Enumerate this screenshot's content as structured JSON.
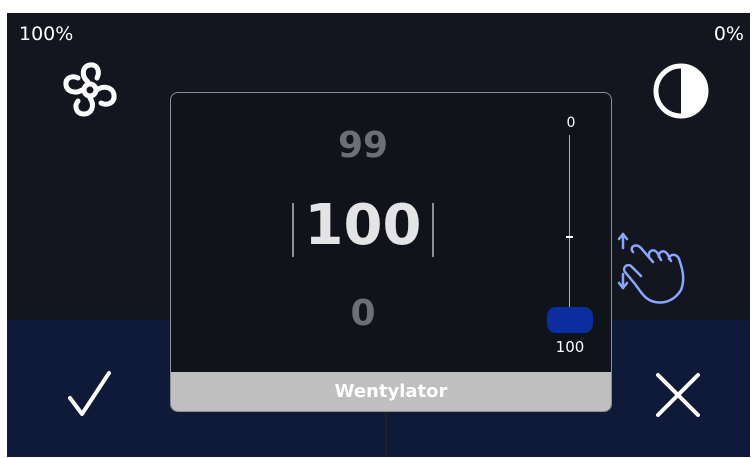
{
  "status": {
    "fan_percent": "100%",
    "contrast_percent": "0%"
  },
  "icons": {
    "fan": "fan-icon",
    "contrast": "contrast-icon",
    "gesture": "swipe-gesture-icon",
    "confirm": "checkmark-icon",
    "cancel": "close-icon"
  },
  "dialog": {
    "title": "Wentylator",
    "picker": {
      "previous": "99",
      "current": "100",
      "next": "0"
    },
    "slider": {
      "min_label": "0",
      "max_label": "100",
      "value": 100,
      "min": 0,
      "max": 100
    }
  },
  "colors": {
    "background": "#13151f",
    "bottom_panel": "#0e1a37",
    "slider_thumb": "#0c2ea0",
    "title_bar": "#bfbfbf",
    "gesture_icon": "#8aa6ff"
  }
}
